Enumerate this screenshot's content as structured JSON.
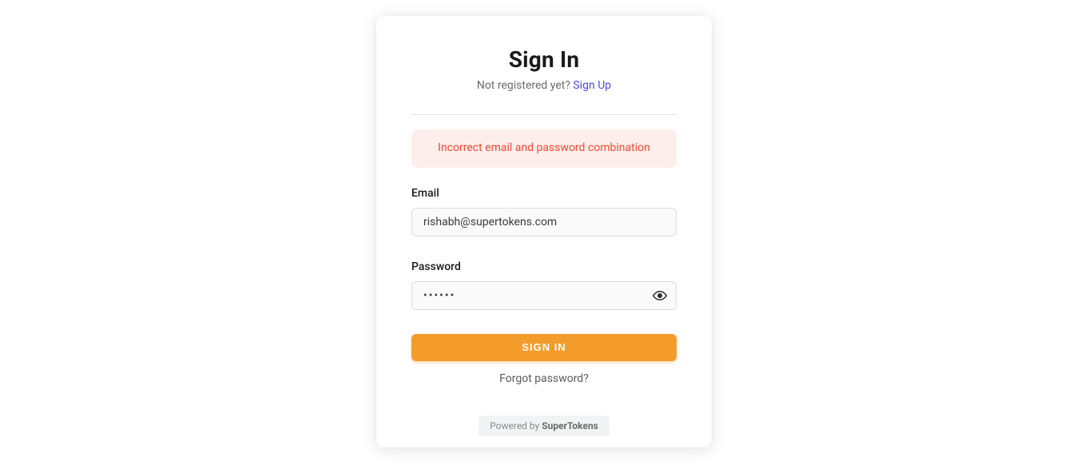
{
  "header": {
    "title": "Sign In",
    "not_registered": "Not registered yet? ",
    "signup": "Sign Up"
  },
  "error": {
    "message": "Incorrect email and password combination"
  },
  "form": {
    "email_label": "Email",
    "email_value": "rishabh@supertokens.com",
    "password_label": "Password",
    "password_value": "••••••",
    "submit_label": "SIGN IN",
    "forgot_label": "Forgot password?"
  },
  "footer": {
    "powered_by": "Powered by ",
    "brand": "SuperTokens"
  }
}
